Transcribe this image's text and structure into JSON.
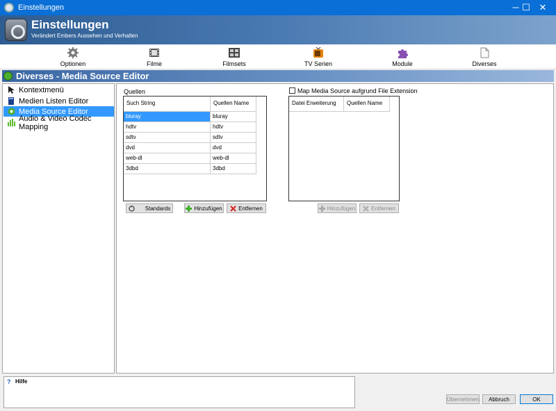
{
  "window": {
    "title": "Einstellungen",
    "min": "─",
    "max": "☐",
    "close": "✕"
  },
  "banner": {
    "title": "Einstellungen",
    "subtitle": "Verändert Embers Aussehen und Verhalten"
  },
  "toolbar": [
    {
      "label": "Optionen",
      "icon": "gear-icon"
    },
    {
      "label": "Filme",
      "icon": "film-icon"
    },
    {
      "label": "Filmsets",
      "icon": "filmset-icon"
    },
    {
      "label": "TV Serien",
      "icon": "tv-icon"
    },
    {
      "label": "Module",
      "icon": "puzzle-icon"
    },
    {
      "label": "Diverses",
      "icon": "document-icon"
    }
  ],
  "section": {
    "title": "Diverses - Media Source Editor"
  },
  "nav": [
    {
      "label": "Kontextmenü",
      "icon": "pointer-icon"
    },
    {
      "label": "Medien Listen Editor",
      "icon": "book-icon"
    },
    {
      "label": "Media Source Editor",
      "icon": "media-source-icon",
      "selected": true
    },
    {
      "label": "Audio & Video Codec Mapping",
      "icon": "equalizer-icon"
    }
  ],
  "sources": {
    "label": "Quellen",
    "columns": [
      "Such String",
      "Quellen Name"
    ],
    "rows": [
      [
        "bluray",
        "bluray"
      ],
      [
        "hdtv",
        "hdtv"
      ],
      [
        "sdtv",
        "sdtv"
      ],
      [
        "dvd",
        "dvd"
      ],
      [
        "web-dl",
        "web-dl"
      ],
      [
        "3dbd",
        "3dbd"
      ]
    ],
    "buttons": {
      "defaults": "Standards",
      "add": "Hinzufügen",
      "remove": "Entfernen"
    }
  },
  "extension": {
    "checkbox_label": "Map Media Source aufgrund File Extension",
    "checked": false,
    "columns": [
      "Datei Erweiterung",
      "Quellen Name"
    ],
    "buttons": {
      "add": "Hinzufügen",
      "remove": "Entfernen"
    }
  },
  "help": {
    "title": "Hilfe",
    "icon": "help-icon"
  },
  "actions": {
    "apply": "Übernehmen",
    "cancel": "Abbruch",
    "ok": "OK"
  },
  "colors": {
    "titlebar": "#0a6fd6",
    "selection": "#3399ff",
    "add": "#3fae29",
    "remove": "#d2241e"
  }
}
